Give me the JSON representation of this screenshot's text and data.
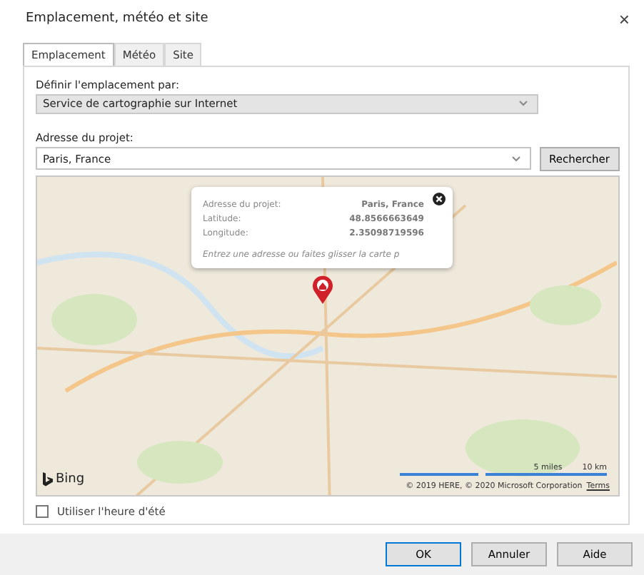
{
  "window": {
    "title": "Emplacement, météo et site",
    "close": "×"
  },
  "tabs": [
    {
      "label": "Emplacement",
      "selected": true
    },
    {
      "label": "Météo",
      "selected": false
    },
    {
      "label": "Site",
      "selected": false
    }
  ],
  "define_by": {
    "label": "Définir l'emplacement par:",
    "value": "Service de cartographie sur Internet"
  },
  "address": {
    "label": "Adresse du projet:",
    "value": "Paris, France",
    "search_button": "Rechercher"
  },
  "map": {
    "popup": {
      "rows": [
        {
          "label": "Adresse du projet:",
          "value": "Paris, France"
        },
        {
          "label": "Latitude:",
          "value": "48.8566663649"
        },
        {
          "label": "Longitude:",
          "value": "2.35098719596"
        }
      ],
      "hint": "Entrez une adresse ou faites glisser la carte p"
    },
    "brand": "Bing",
    "scale_miles": "5 miles",
    "scale_km": "10 km",
    "copyright": "© 2019 HERE, © 2020 Microsoft Corporation",
    "terms": "Terms"
  },
  "daylight_saving": {
    "label": "Utiliser l'heure d'été",
    "checked": false
  },
  "buttons": [
    {
      "label": "OK",
      "kind": "default"
    },
    {
      "label": "Annuler",
      "kind": "normal"
    },
    {
      "label": "Aide",
      "kind": "normal"
    }
  ]
}
